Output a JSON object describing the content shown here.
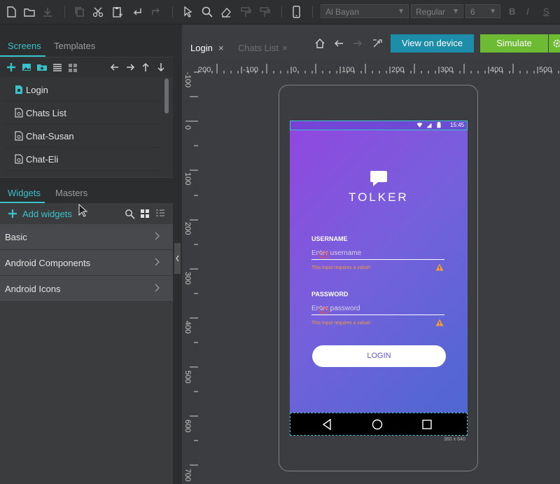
{
  "toolbar": {
    "font_family": "Al Bayan",
    "font_weight": "Regular",
    "font_size": "6",
    "bold": "B",
    "italic": "I",
    "underline": "S"
  },
  "screens_panel": {
    "tabs": [
      "Screens",
      "Templates"
    ],
    "items": [
      {
        "label": "Login",
        "active": true
      },
      {
        "label": "Chats List",
        "active": false
      },
      {
        "label": "Chat-Susan",
        "active": false
      },
      {
        "label": "Chat-Eli",
        "active": false
      }
    ]
  },
  "widgets_panel": {
    "tabs": [
      "Widgets",
      "Masters"
    ],
    "add_label": "Add widgets",
    "categories": [
      "Basic",
      "Android Components",
      "Android Icons"
    ]
  },
  "canvas": {
    "tabs": [
      {
        "label": "Login",
        "close": "×"
      },
      {
        "label": "Chats List",
        "close": "×"
      }
    ],
    "view_on_device": "View on device",
    "simulate": "Simulate",
    "ruler_h": [
      "200",
      "-100",
      "0",
      "100",
      "200",
      "300",
      "400",
      "500"
    ],
    "ruler_v": [
      "-100",
      "0",
      "100",
      "200",
      "300",
      "400",
      "500",
      "600",
      "700"
    ],
    "size_label": "360 x 640"
  },
  "app": {
    "status_time": "15:45",
    "brand": "TOLKER",
    "username_label": "USERNAME",
    "username_placeholder": "Enter username",
    "username_error": "This input requires a value!",
    "password_label": "PASSWORD",
    "password_placeholder": "Enter password",
    "password_error": "This input requires a value!",
    "login_button": "LOGIN"
  },
  "colors": {
    "accent": "#3ac2c9",
    "view_on_device_bg": "#1d8eaa",
    "simulate_bg": "#6dbb33",
    "gradient_start": "#9147e0",
    "gradient_end": "#4a68d2",
    "error": "#f29d3a"
  }
}
